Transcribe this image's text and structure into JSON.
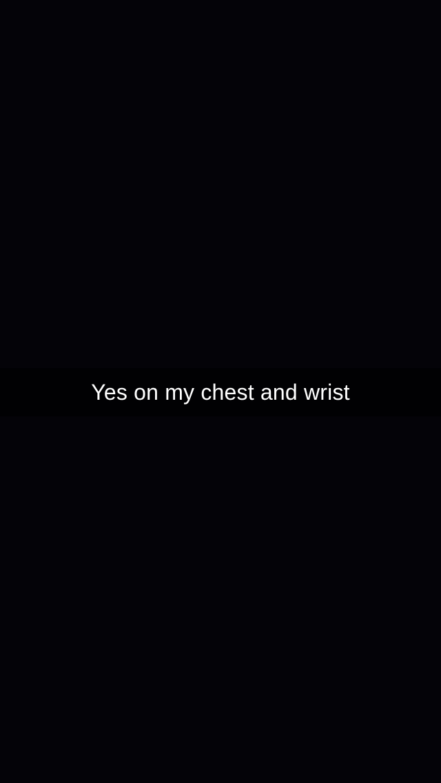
{
  "caption": {
    "text": "Yes on my chest and wrist"
  },
  "colors": {
    "background": "#040308",
    "caption_text": "#ffffff"
  }
}
